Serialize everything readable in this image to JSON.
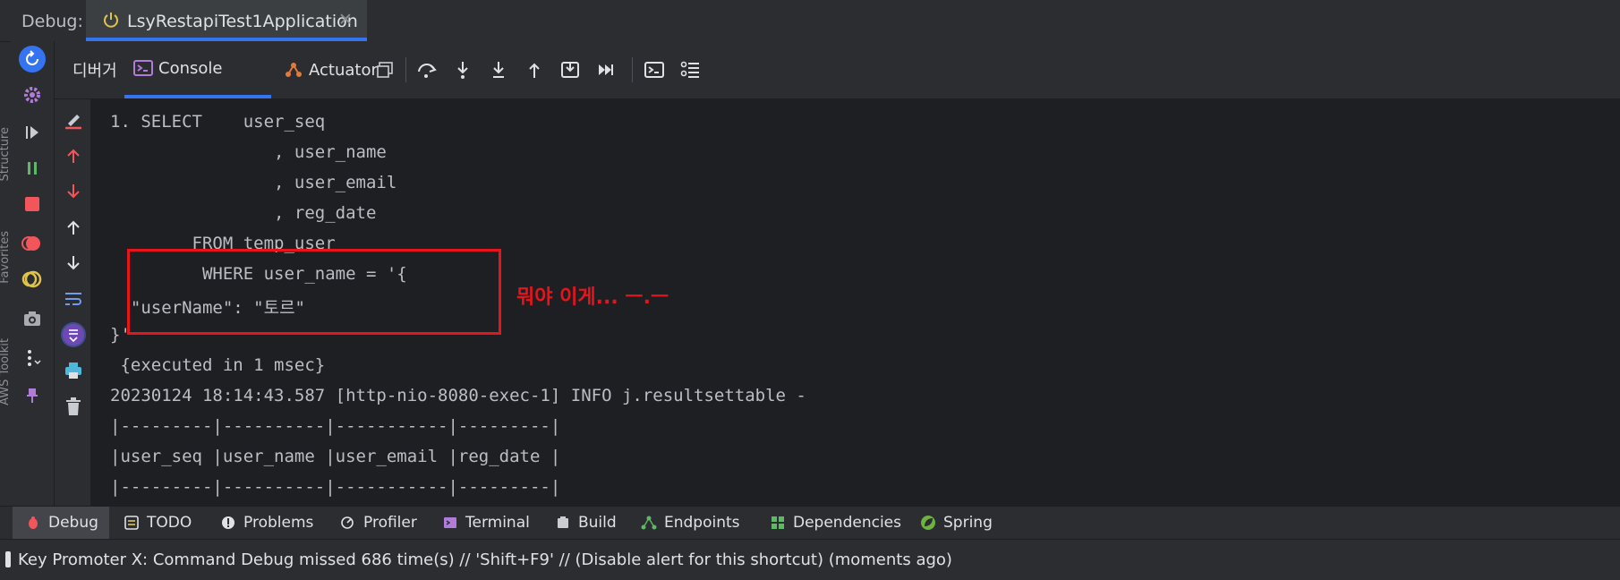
{
  "window": {
    "debug_label": "Debug:",
    "run_tab": "LsyRestapiTest1Application"
  },
  "side_labels": [
    "Structure",
    "Favorites",
    "AWS Toolkit"
  ],
  "toolbar": {
    "tabs": [
      "디버거",
      "Console",
      "Actuator"
    ]
  },
  "console": {
    "lines": [
      "1. SELECT    user_seq",
      "                , user_name",
      "                , user_email",
      "                , reg_date",
      "        FROM temp_user",
      "         WHERE user_name = '{",
      "  \"userName\": \"토르\"",
      "}'",
      " {executed in 1 msec}",
      "20230124 18:14:43.587 [http-nio-8080-exec-1] INFO j.resultsettable -",
      "|---------|----------|-----------|---------|",
      "|user_seq |user_name |user_email |reg_date |",
      "|---------|----------|-----------|---------|"
    ],
    "cut_top": "                                                                                              "
  },
  "annotation": {
    "text": "뭐야 이게... ㅡ.ㅡ",
    "color": "#e8141b"
  },
  "bottom_tabs": [
    "Debug",
    "TODO",
    "Problems",
    "Profiler",
    "Terminal",
    "Build",
    "Endpoints",
    "Dependencies",
    "Spring"
  ],
  "status": {
    "message": "Key Promoter X: Command Debug missed 686 time(s) // 'Shift+F9' // (Disable alert for this shortcut) (moments ago)"
  },
  "colors": {
    "accent": "#3574f0",
    "background": "#2b2d30",
    "console_bg": "#1e1f22",
    "text": "#bcbec4"
  }
}
